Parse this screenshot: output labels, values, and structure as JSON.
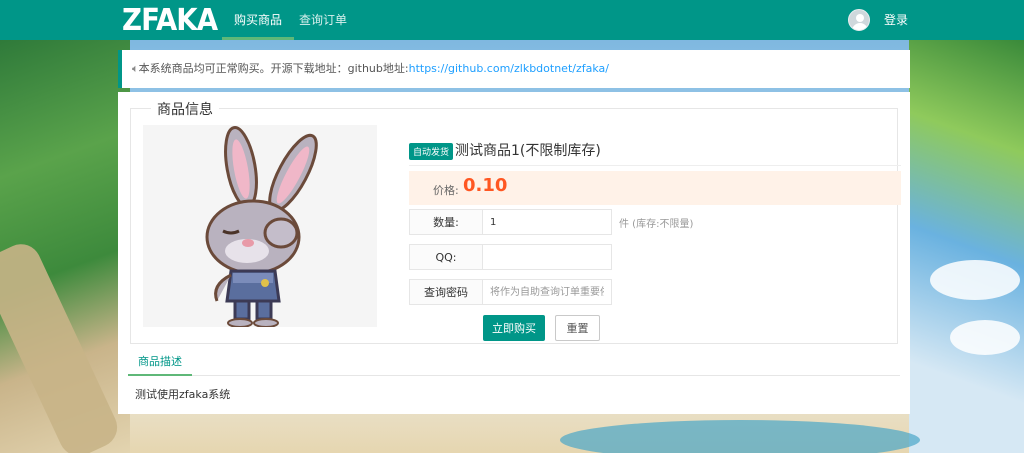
{
  "nav": {
    "logo": "ZFAKA",
    "items": [
      {
        "label": "购买商品",
        "active": true
      },
      {
        "label": "查询订单",
        "active": false
      }
    ],
    "login": "登录",
    "accent_color": "#009688"
  },
  "notice": {
    "icon": "volume-icon",
    "text": "本系统商品均可正常购买。开源下载地址：github地址:",
    "link": "https://github.com/zlkbdotnet/zfaka/"
  },
  "product": {
    "section_title": "商品信息",
    "image": "rabbit-cartoon-image",
    "tag": "自动发货",
    "title": "测试商品1(不限制库存)",
    "price_label": "价格:",
    "price": "0.10",
    "quantity_label": "数量:",
    "quantity_value": "1",
    "stock_text": "件 (库存:不限量)",
    "qq_label": "QQ:",
    "qq_value": "",
    "password_label": "查询密码",
    "password_placeholder": "将作为自助查询订单重要依据",
    "buy_button": "立即购买",
    "reset_button": "重置"
  },
  "tabs": {
    "description_tab": "商品描述",
    "description_text": "测试使用zfaka系统"
  }
}
